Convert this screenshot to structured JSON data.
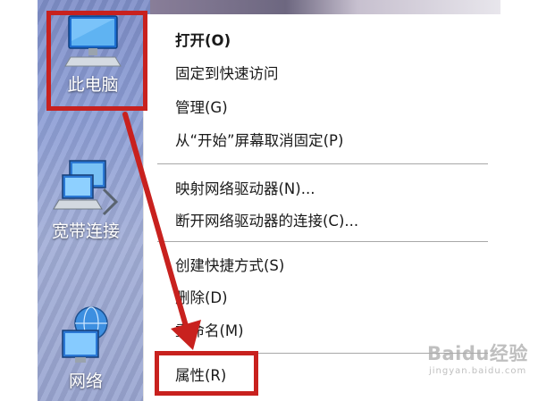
{
  "desktop": {
    "icons": [
      {
        "label": "此电脑",
        "icon": "computer-icon"
      },
      {
        "label": "宽带连接",
        "icon": "network-connection-icon"
      },
      {
        "label": "网络",
        "icon": "network-globe-icon"
      }
    ]
  },
  "context_menu": {
    "items": [
      {
        "label": "打开(O)",
        "bold": true
      },
      {
        "label": "固定到快速访问"
      },
      {
        "label": "管理(G)"
      },
      {
        "label": "从“开始”屏幕取消固定(P)"
      },
      {
        "label": "映射网络驱动器(N)..."
      },
      {
        "label": "断开网络驱动器的连接(C)..."
      },
      {
        "label": "创建快捷方式(S)"
      },
      {
        "label": "删除(D)"
      },
      {
        "label": "重命名(M)"
      },
      {
        "label": "属性(R)"
      }
    ]
  },
  "annotation": {
    "highlight_color": "#c8211e",
    "arrow_color": "#c8211e"
  },
  "watermark": {
    "brand": "Baidu经验",
    "url": "jingyan.baidu.com"
  }
}
